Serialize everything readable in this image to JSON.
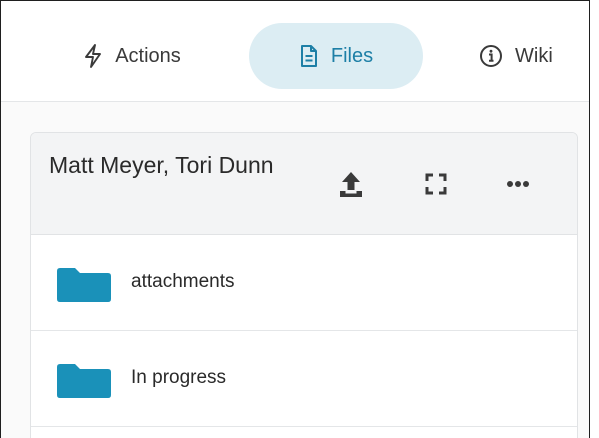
{
  "tabs": [
    {
      "id": "actions",
      "label": "Actions",
      "icon": "lightning-icon"
    },
    {
      "id": "files",
      "label": "Files",
      "icon": "document-icon",
      "active": true
    },
    {
      "id": "wiki",
      "label": "Wiki",
      "icon": "info-icon"
    }
  ],
  "panel": {
    "title": "Matt Meyer, Tori Dunn",
    "actions": [
      "upload-icon",
      "expand-icon",
      "more-icon"
    ]
  },
  "folders": [
    {
      "name": "attachments",
      "icon": "folder-icon"
    },
    {
      "name": "In progress",
      "icon": "folder-icon"
    }
  ],
  "colors": {
    "accent": "#1d7fa6",
    "active_tab_bg": "#dcedf3",
    "folder": "#1a91b9",
    "header_bg": "#f3f4f5"
  }
}
